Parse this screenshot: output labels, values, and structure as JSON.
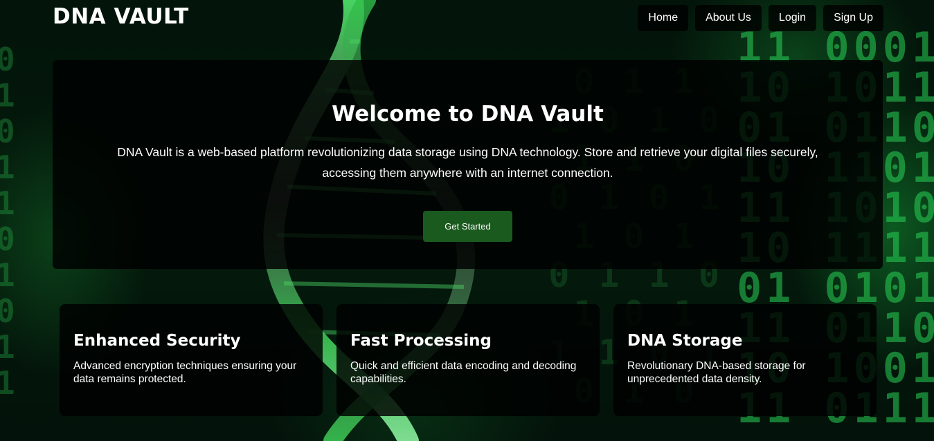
{
  "brand": {
    "name": "DNA VAULT"
  },
  "nav": {
    "items": [
      {
        "label": "Home"
      },
      {
        "label": "About Us"
      },
      {
        "label": "Login"
      },
      {
        "label": "Sign Up"
      }
    ]
  },
  "hero": {
    "title": "Welcome to DNA Vault",
    "description": "DNA Vault is a web-based platform revolutionizing data storage using DNA technology. Store and retrieve your digital files securely, accessing them anywhere with an internet connection.",
    "cta_label": "Get Started"
  },
  "features": [
    {
      "title": "Enhanced Security",
      "description": "Advanced encryption techniques ensuring your data remains protected."
    },
    {
      "title": "Fast Processing",
      "description": "Quick and efficient data encoding and decoding capabilities."
    },
    {
      "title": "DNA Storage",
      "description": "Revolutionary DNA-based storage for unprecedented data density."
    }
  ],
  "colors": {
    "accent": "#1a5a1e",
    "background": "#03140a",
    "binary_glow": "#28d255"
  }
}
